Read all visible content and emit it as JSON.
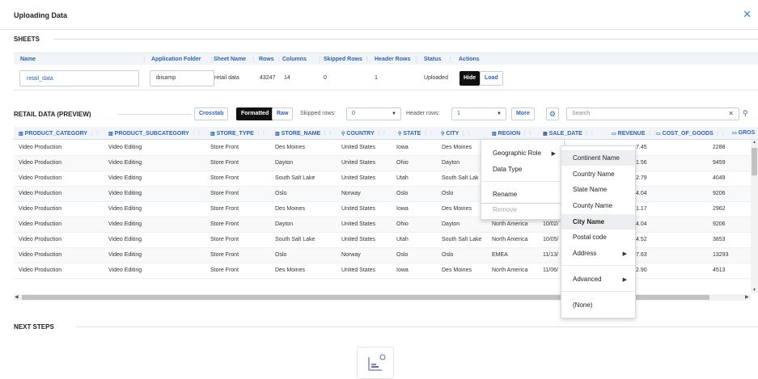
{
  "dialog": {
    "title": "Uploading Data",
    "close_icon": "close-icon"
  },
  "sheets": {
    "section_title": "SHEETS",
    "columns": [
      "Name",
      "Application Folder",
      "Sheet Name",
      "Rows",
      "Columns",
      "Skipped Rows",
      "Header Rows",
      "Status",
      "Actions"
    ],
    "row": {
      "name": "retail_data",
      "folder": "ibisamp",
      "sheet_name": "retail data",
      "rows": "43247",
      "columns": "14",
      "skipped_rows": "0",
      "header_rows": "1",
      "status": "Uploaded",
      "hide_label": "Hide",
      "load_label": "Load"
    }
  },
  "preview": {
    "section_title": "RETAIL DATA (PREVIEW)",
    "crosstab_label": "Crosstab",
    "formatted_label": "Formatted",
    "raw_label": "Raw",
    "skipped_rows_label": "Skipped rows:",
    "skipped_rows_value": "0",
    "header_rows_label": "Header rows:",
    "header_rows_value": "1",
    "more_label": "More",
    "search_placeholder": "Search",
    "columns": [
      {
        "label": "PRODUCT_CATEGORY",
        "type": "dimension"
      },
      {
        "label": "PRODUCT_SUBCATEGORY",
        "type": "dimension"
      },
      {
        "label": "STORE_TYPE",
        "type": "dimension"
      },
      {
        "label": "STORE_NAME",
        "type": "dimension"
      },
      {
        "label": "COUNTRY",
        "type": "geo"
      },
      {
        "label": "STATE",
        "type": "geo"
      },
      {
        "label": "CITY",
        "type": "geo"
      },
      {
        "label": "REGION",
        "type": "dimension"
      },
      {
        "label": "SALE_DATE",
        "type": "date"
      },
      {
        "label": "REVENUE",
        "type": "measure"
      },
      {
        "label": "COST_OF_GOODS",
        "type": "measure"
      },
      {
        "label": "GROS",
        "type": "measure"
      }
    ],
    "rows": [
      {
        "cat": "Video Production",
        "sub": "Video Editing",
        "type": "Store Front",
        "name": "Des Moines",
        "country": "United States",
        "state": "Iowa",
        "city": "Des Moines",
        "region": "",
        "date": "",
        "rev": "7.45",
        "cogs": "2288"
      },
      {
        "cat": "Video Production",
        "sub": "Video Editing",
        "type": "Store Front",
        "name": "Dayton",
        "country": "United States",
        "state": "Ohio",
        "city": "Dayton",
        "region": "",
        "date": "",
        "rev": "1.56",
        "cogs": "9459"
      },
      {
        "cat": "Video Production",
        "sub": "Video Editing",
        "type": "Store Front",
        "name": "South Salt Lake",
        "country": "United States",
        "state": "Utah",
        "city": "South Salt Lak",
        "region": "",
        "date": "",
        "rev": "2.79",
        "cogs": "4049"
      },
      {
        "cat": "Video Production",
        "sub": "Video Editing",
        "type": "Store Front",
        "name": "Oslo",
        "country": "Norway",
        "state": "Oslo",
        "city": "Oslo",
        "region": "",
        "date": "",
        "rev": "4.04",
        "cogs": "9206"
      },
      {
        "cat": "Video Production",
        "sub": "Video Editing",
        "type": "Store Front",
        "name": "Des Moines",
        "country": "United States",
        "state": "Iowa",
        "city": "Des Moines",
        "region": "",
        "date": "",
        "rev": "1.17",
        "cogs": "2962"
      },
      {
        "cat": "Video Production",
        "sub": "Video Editing",
        "type": "Store Front",
        "name": "Dayton",
        "country": "United States",
        "state": "Ohio",
        "city": "Dayton",
        "region": "North America",
        "date": "10/02/",
        "rev": "4.04",
        "cogs": "9206"
      },
      {
        "cat": "Video Production",
        "sub": "Video Editing",
        "type": "Store Front",
        "name": "South Salt Lake",
        "country": "United States",
        "state": "Utah",
        "city": "South Salt Lake",
        "region": "North America",
        "date": "10/05/",
        "rev": "4.52",
        "cogs": "3853"
      },
      {
        "cat": "Video Production",
        "sub": "Video Editing",
        "type": "Store Front",
        "name": "Oslo",
        "country": "Norway",
        "state": "Oslo",
        "city": "Oslo",
        "region": "EMEA",
        "date": "11/13/",
        "rev": "7.63",
        "cogs": "13293"
      },
      {
        "cat": "Video Production",
        "sub": "Video Editing",
        "type": "Store Front",
        "name": "Des Moines",
        "country": "United States",
        "state": "Iowa",
        "city": "Des Moines",
        "region": "North America",
        "date": "11/06/",
        "rev": "2.90",
        "cogs": "4513"
      }
    ]
  },
  "context_menu": {
    "items": [
      "Geographic Role",
      "Data Type",
      "Rename",
      "Remove"
    ],
    "submenu": [
      "Continent Name",
      "Country Name",
      "State Name",
      "County Name",
      "City Name",
      "Postal code",
      "Address",
      "Advanced",
      "(None)"
    ]
  },
  "next_steps": {
    "section_title": "NEXT STEPS"
  },
  "colors": {
    "accent": "#2e64b3",
    "dark_button": "#111111"
  }
}
